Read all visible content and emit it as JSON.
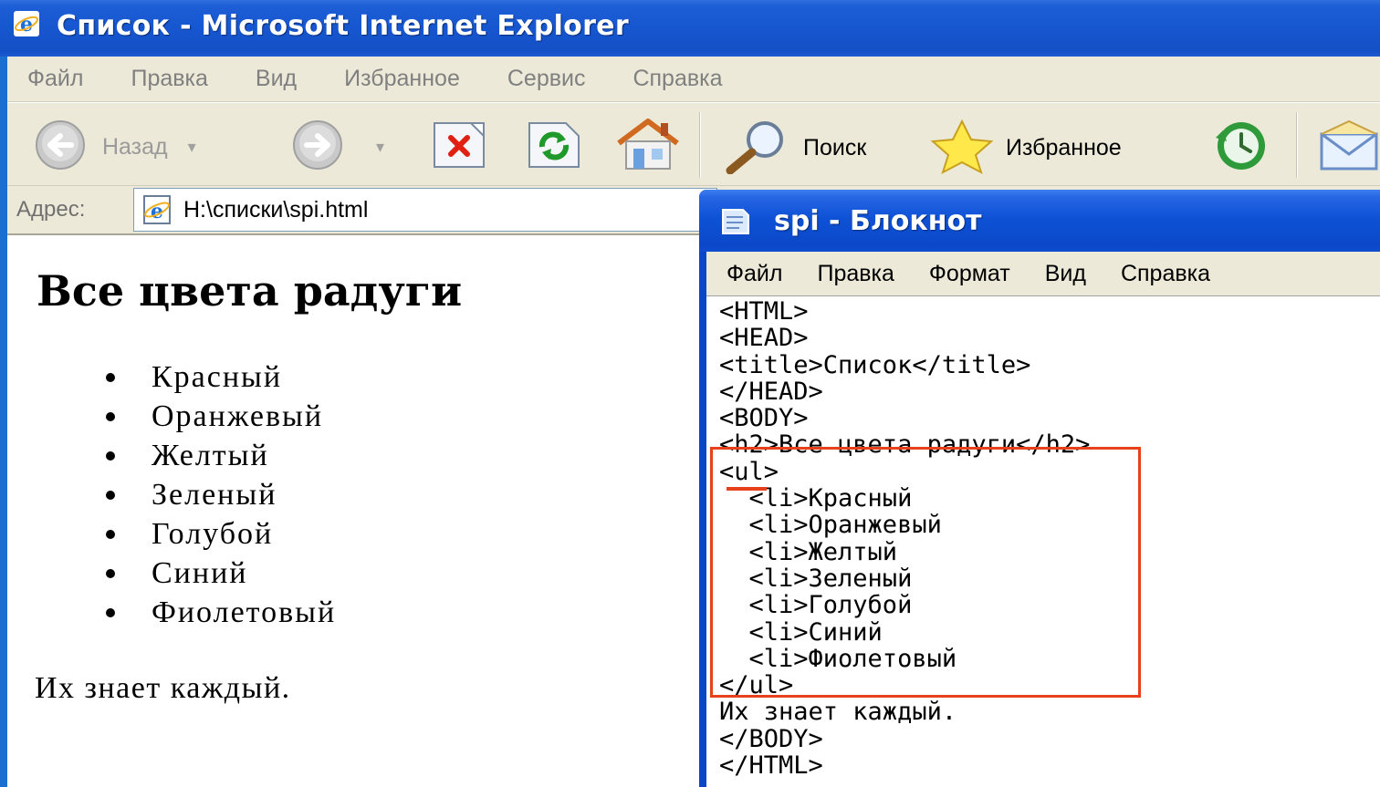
{
  "ie": {
    "title": "Список - Microsoft Internet Explorer",
    "menu": [
      "Файл",
      "Правка",
      "Вид",
      "Избранное",
      "Сервис",
      "Справка"
    ],
    "toolbar": {
      "back_label": "Назад",
      "search_label": "Поиск",
      "favorites_label": "Избранное"
    },
    "address": {
      "label": "Адрес:",
      "value": "H:\\списки\\spi.html"
    },
    "page": {
      "heading": "Все цвета радуги",
      "items": [
        "Красный",
        "Оранжевый",
        "Желтый",
        "Зеленый",
        "Голубой",
        "Синий",
        "Фиолетовый"
      ],
      "footer": "Их знает каждый."
    }
  },
  "notepad": {
    "title": "spi - Блокнот",
    "menu": [
      "Файл",
      "Правка",
      "Формат",
      "Вид",
      "Справка"
    ],
    "lines": [
      "<HTML>",
      "<HEAD>",
      "<title>Список</title>",
      "</HEAD>",
      "<BODY>",
      "<h2>Все цвета радуги</h2>",
      "<ul>",
      "  <li>Красный",
      "  <li>Оранжевый",
      "  <li>Желтый",
      "  <li>Зеленый",
      "  <li>Голубой",
      "  <li>Синий",
      "  <li>Фиолетовый",
      "</ul>",
      "Их знает каждый.",
      "</BODY>",
      "</HTML>"
    ]
  },
  "colors": {
    "titlebar": "#1656cf",
    "chrome": "#ece9d8",
    "highlight": "#e8401a"
  },
  "icons": [
    "ie-logo-icon",
    "back-arrow-icon",
    "forward-arrow-icon",
    "stop-icon",
    "refresh-icon",
    "home-icon",
    "search-magnifier-icon",
    "favorites-star-icon",
    "history-icon",
    "mail-icon",
    "notepad-icon"
  ]
}
